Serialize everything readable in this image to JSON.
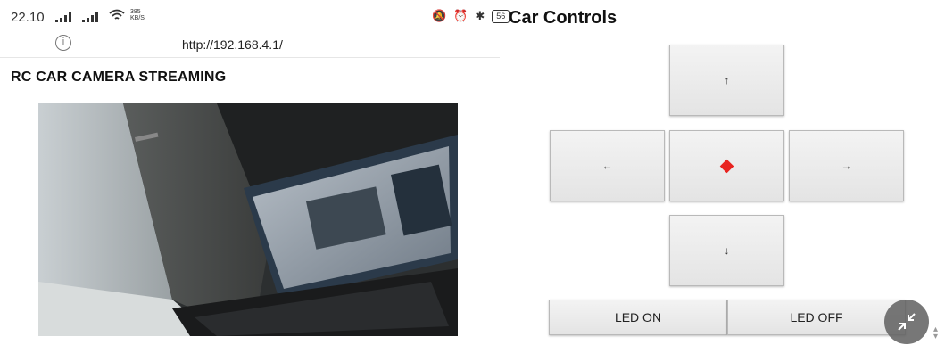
{
  "status_bar": {
    "time": "22.10",
    "net_speed_value": "385",
    "net_speed_unit": "KB/S",
    "battery": "56",
    "icons": [
      "signal-icon",
      "signal-icon",
      "wifi-icon",
      "mute-icon",
      "alarm-icon",
      "bluetooth-icon",
      "battery-icon"
    ]
  },
  "browser": {
    "url": "http://192.168.4.1/",
    "info_icon": "info-icon"
  },
  "page": {
    "title": "RC CAR CAMERA STREAMING"
  },
  "controls": {
    "title": "Car Controls",
    "up_label": "↑",
    "left_label": "←",
    "right_label": "→",
    "down_label": "↓",
    "stop_icon": "stop-diamond-icon",
    "led_on_label": "LED ON",
    "led_off_label": "LED OFF",
    "stop_color": "#e8231f"
  },
  "floating_button": {
    "icon": "collapse-arrows-icon"
  }
}
